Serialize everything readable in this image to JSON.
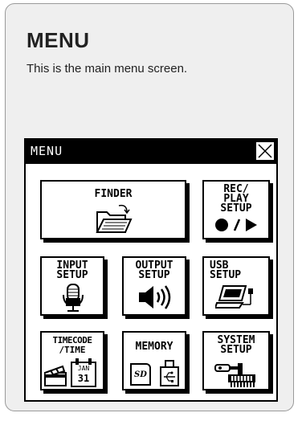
{
  "page": {
    "title": "MENU",
    "description": "This is the main menu screen."
  },
  "screen": {
    "title": "MENU",
    "buttons": {
      "finder": {
        "label": "FINDER"
      },
      "rec_play_setup": {
        "line1": "REC/",
        "line2": "PLAY",
        "line3": "SETUP"
      },
      "input_setup": {
        "line1": "INPUT",
        "line2": "SETUP"
      },
      "output_setup": {
        "line1": "OUTPUT",
        "line2": "SETUP"
      },
      "usb_setup": {
        "line1": "USB",
        "line2": "SETUP"
      },
      "timecode_time": {
        "line1": "TIMECODE",
        "line2": "/TIME",
        "cal_month": "JAN",
        "cal_day": "31"
      },
      "memory": {
        "label": "MEMORY",
        "sd_badge": "SD"
      },
      "system_setup": {
        "line1": "SYSTEM",
        "line2": "SETUP"
      }
    }
  },
  "colors": {
    "background": "#ffffff",
    "card": "#efefef",
    "ink": "#000000"
  }
}
